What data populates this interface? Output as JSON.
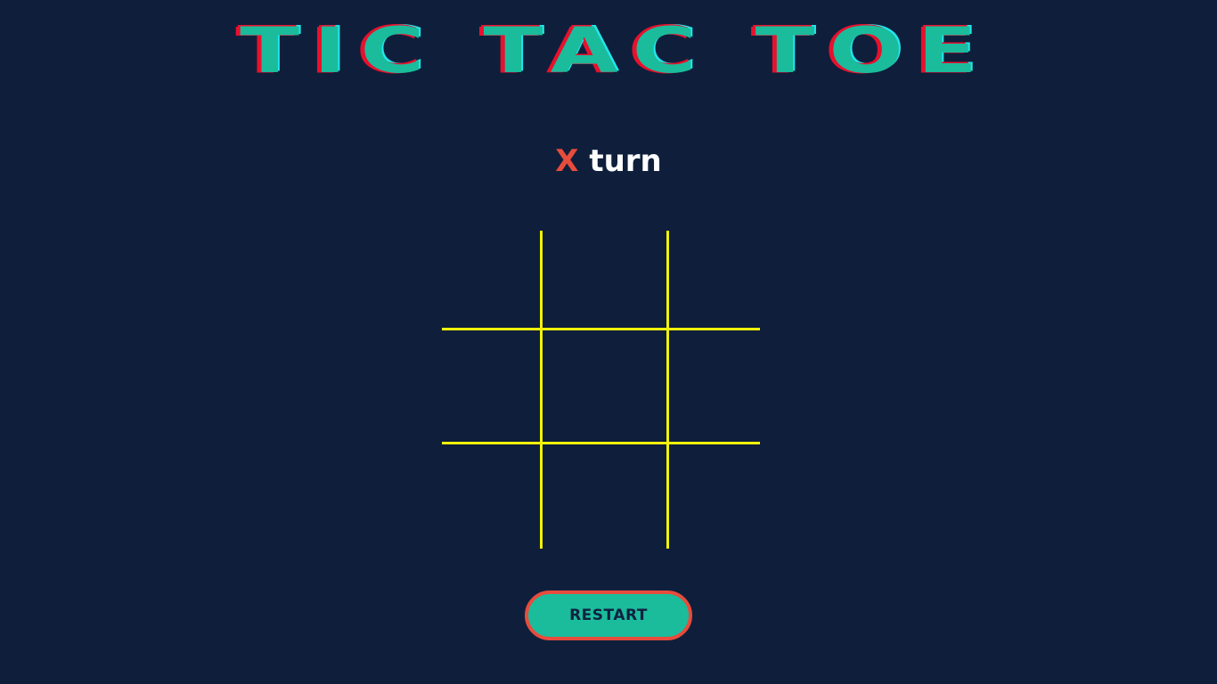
{
  "title": "TIC TAC TOE",
  "status": {
    "current_player": "X",
    "suffix": "turn"
  },
  "board": {
    "cells": [
      "",
      "",
      "",
      "",
      "",
      "",
      "",
      "",
      ""
    ]
  },
  "restart_label": "RESTART",
  "colors": {
    "background": "#0f1f3b",
    "title_fill": "#1abc9c",
    "title_shadow_red": "#e8112d",
    "title_shadow_cyan": "#22e6ee",
    "player_x": "#e74c3c",
    "grid_lines": "#f2f20a",
    "button_fill": "#1abc9c",
    "button_border": "#e74c3c",
    "button_text": "#10213f"
  }
}
